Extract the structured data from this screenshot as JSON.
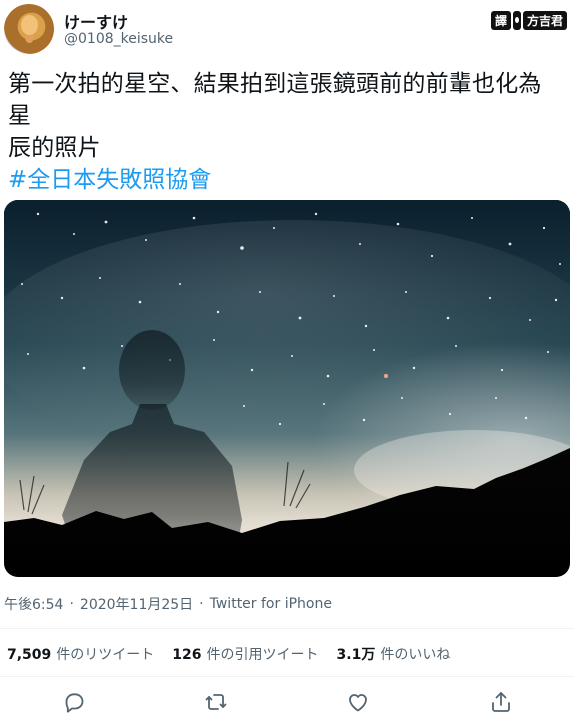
{
  "author": {
    "display_name": "けーすけ",
    "handle": "@0108_keisuke"
  },
  "badge": {
    "left": "譯",
    "right": "方吉君"
  },
  "tweet": {
    "text_line1": "第一次拍的星空、結果拍到這張鏡頭前的前輩也化為星",
    "text_line2": "辰的照片",
    "hashtag": "#全日本失敗照協會"
  },
  "meta": {
    "time": "午後6:54",
    "separator": "·",
    "date": "2020年11月25日",
    "source": "Twitter for iPhone"
  },
  "stats": [
    {
      "count": "7,509",
      "label": "件のリツイート"
    },
    {
      "count": "126",
      "label": "件の引用ツイート"
    },
    {
      "count": "3.1万",
      "label": "件のいいね"
    }
  ],
  "colors": {
    "text": "#0f1419",
    "secondary": "#536471",
    "accent": "#1d9bf0",
    "divider": "#eff3f4"
  },
  "icons": {
    "reply": "reply-icon",
    "retweet": "retweet-icon",
    "like": "like-icon",
    "share": "share-icon"
  }
}
